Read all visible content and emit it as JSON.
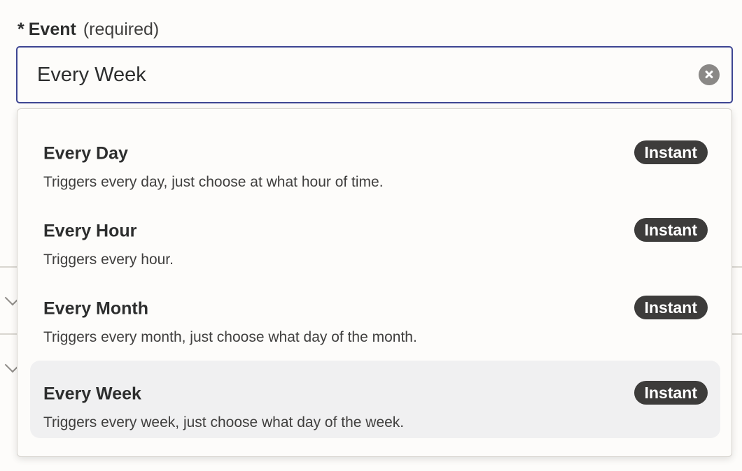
{
  "field": {
    "required_marker": "*",
    "label": "Event",
    "hint": "(required)"
  },
  "search": {
    "value": "Every Week",
    "clear_icon": "clear-circle-x-icon"
  },
  "options": [
    {
      "title": "Every Day",
      "description": "Triggers every day, just choose at what hour of time.",
      "badge": "Instant",
      "highlighted": false
    },
    {
      "title": "Every Hour",
      "description": "Triggers every hour.",
      "badge": "Instant",
      "highlighted": false
    },
    {
      "title": "Every Month",
      "description": "Triggers every month, just choose what day of the month.",
      "badge": "Instant",
      "highlighted": false
    },
    {
      "title": "Every Week",
      "description": "Triggers every week, just choose what day of the week.",
      "badge": "Instant",
      "highlighted": true
    }
  ],
  "colors": {
    "input_focus_border": "#3d4592",
    "badge_background": "#3d3c3b",
    "highlight_background": "#f0f0f1"
  }
}
